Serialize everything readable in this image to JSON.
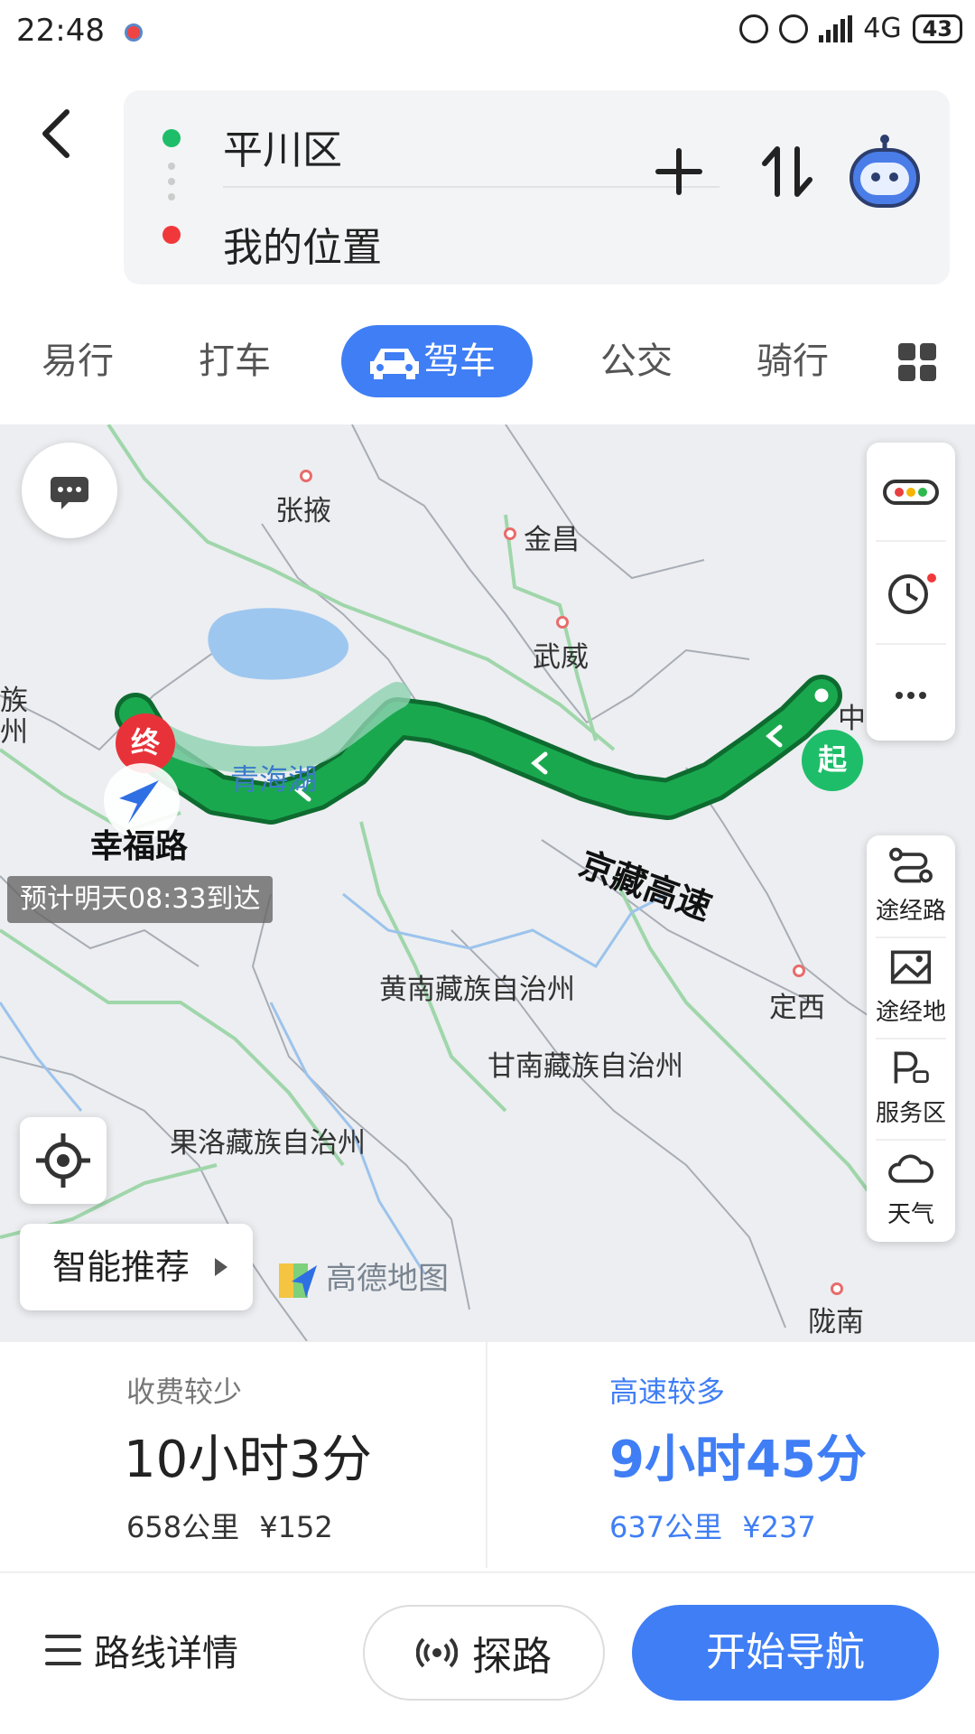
{
  "status_bar": {
    "time": "22:48",
    "network": "4G",
    "battery": "43"
  },
  "route_input": {
    "start": "平川区",
    "end": "我的位置"
  },
  "mode_tabs": [
    {
      "label": "易行"
    },
    {
      "label": "打车"
    },
    {
      "label": "驾车",
      "active": true
    },
    {
      "label": "公交"
    },
    {
      "label": "骑行"
    }
  ],
  "map": {
    "cities": {
      "zhangye": "张掖",
      "jinchang": "金昌",
      "wuwei": "武威",
      "huangnan": "黄南藏族自治州",
      "gannan": "甘南藏族自治州",
      "guoluo": "果洛藏族自治州",
      "dingxi": "定西",
      "longnan": "陇南",
      "edge_zu": "族",
      "edge_zhou": "州",
      "edge_zhong": "中"
    },
    "lake": "青海湖",
    "road": "京藏高速",
    "destination_label": "幸福路",
    "arrival": "预计明天08:33到达",
    "start_marker": "起",
    "end_marker": "终",
    "smart_recommend": "智能推荐",
    "logo": "高德地图",
    "tools": {
      "waypoint_road": "途经路",
      "waypoint_place": "途经地",
      "service_area": "服务区",
      "weather": "天气"
    }
  },
  "routes": [
    {
      "tag": "收费较少",
      "duration": "10小时3分",
      "distance": "658公里",
      "toll": "¥152",
      "selected": false
    },
    {
      "tag": "高速较多",
      "duration": "9小时45分",
      "distance": "637公里",
      "toll": "¥237",
      "selected": true
    }
  ],
  "bottom": {
    "details": "路线详情",
    "probe": "探路",
    "start_nav": "开始导航"
  },
  "colors": {
    "accent": "#3f7ef5",
    "route": "#1aa84f",
    "start": "#1ebd6a",
    "end": "#e8323a"
  }
}
